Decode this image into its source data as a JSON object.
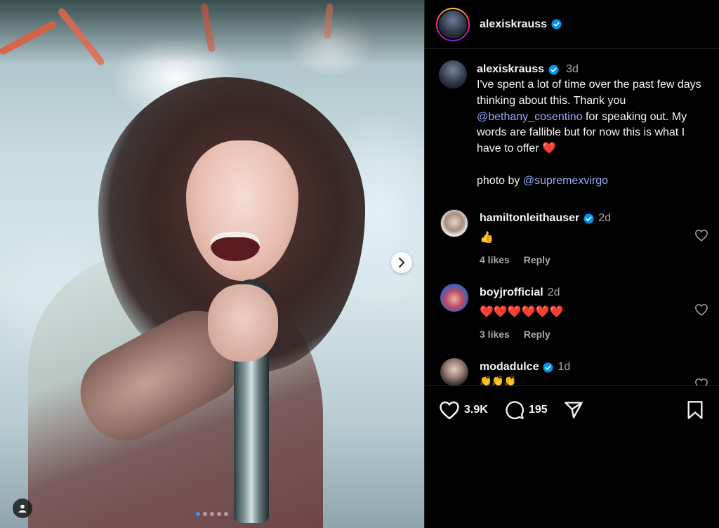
{
  "post": {
    "author": "alexiskrauss",
    "caption": {
      "time": "3d",
      "line1": "I've spent a lot of time over the past few days thinking about this. Thank you ",
      "mention1": "@bethany_cosentino",
      "line2": " for speaking out. My words are fallible but for now this is what I have to offer ❤️",
      "photo_credit_prefix": "photo by ",
      "mention2": "@supremexvirgo"
    }
  },
  "comments": [
    {
      "username": "hamiltonleithauser",
      "verified": true,
      "time": "2d",
      "text": "👍",
      "likes": "4 likes",
      "reply": "Reply"
    },
    {
      "username": "boyjrofficial",
      "verified": false,
      "time": "2d",
      "text": "❤️❤️❤️❤️❤️❤️",
      "likes": "3 likes",
      "reply": "Reply"
    },
    {
      "username": "modadulce",
      "verified": true,
      "time": "1d",
      "text": "👏👏👏"
    }
  ],
  "actions": {
    "likes": "3.9K",
    "comments": "195"
  },
  "icons": {
    "verified": "verified-badge-icon",
    "heart": "heart-icon",
    "comment": "comment-icon",
    "share": "share-icon",
    "save": "bookmark-icon",
    "next": "chevron-right-icon",
    "tag": "user-tag-icon"
  },
  "colors": {
    "verified": "#0095f6",
    "mention": "#93aff8",
    "muted": "#a8a8a8",
    "active_dot": "#3897f0"
  }
}
